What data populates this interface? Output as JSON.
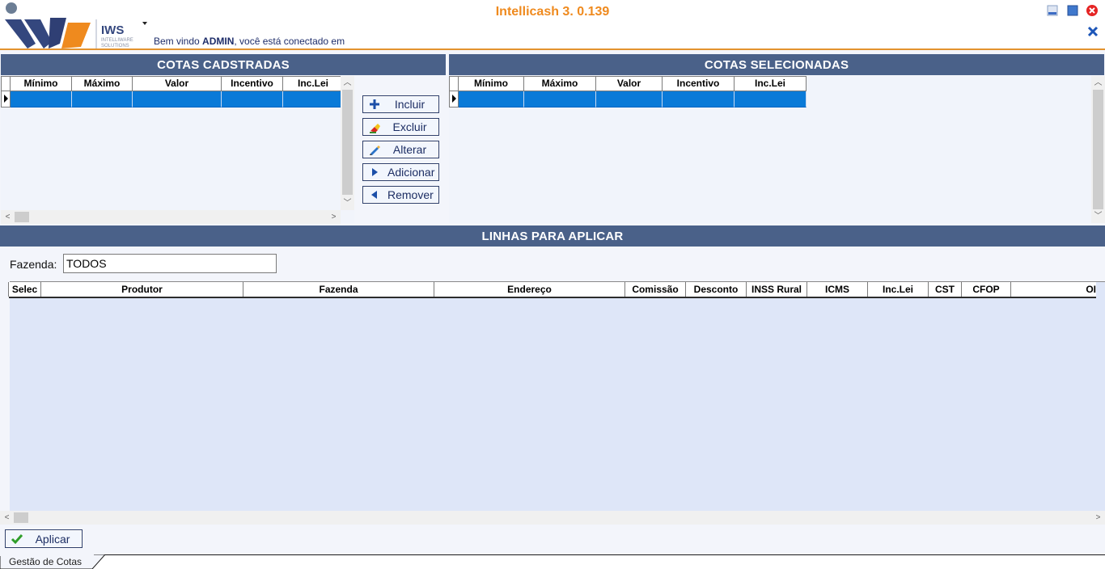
{
  "header": {
    "app_title": "Intellicash 3. 0.139",
    "welcome_prefix": "Bem vindo ",
    "welcome_user": "ADMIN",
    "welcome_suffix": ", você está conectado em",
    "logo_text": "IWS",
    "logo_subtext_1": "INTELLIWARE",
    "logo_subtext_2": "SOLUTIONS"
  },
  "cotas_cadastradas": {
    "title": "COTAS CADSTRADAS",
    "columns": [
      "Mínimo",
      "Máximo",
      "Valor",
      "Incentivo",
      "Inc.Lei"
    ]
  },
  "cotas_selecionadas": {
    "title": "COTAS SELECIONADAS",
    "columns": [
      "Mínimo",
      "Máximo",
      "Valor",
      "Incentivo",
      "Inc.Lei"
    ]
  },
  "actions": {
    "incluir": "Incluir",
    "excluir": "Excluir",
    "alterar": "Alterar",
    "adicionar": "Adicionar",
    "remover": "Remover"
  },
  "linhas": {
    "title": "LINHAS PARA APLICAR",
    "fazenda_label": "Fazenda:",
    "fazenda_value": "TODOS",
    "columns": [
      "Selec",
      "Produtor",
      "Fazenda",
      "Endereço",
      "Comissão",
      "Desconto",
      "INSS Rural",
      "ICMS",
      "Inc.Lei",
      "CST",
      "CFOP",
      "OI"
    ]
  },
  "footer": {
    "aplicar": "Aplicar",
    "tab_label": "Gestão de Cotas"
  },
  "colors": {
    "header_accent": "#ef8a1e",
    "panel_title_bg": "#4a6189",
    "selected_row": "#0a7ad8"
  }
}
